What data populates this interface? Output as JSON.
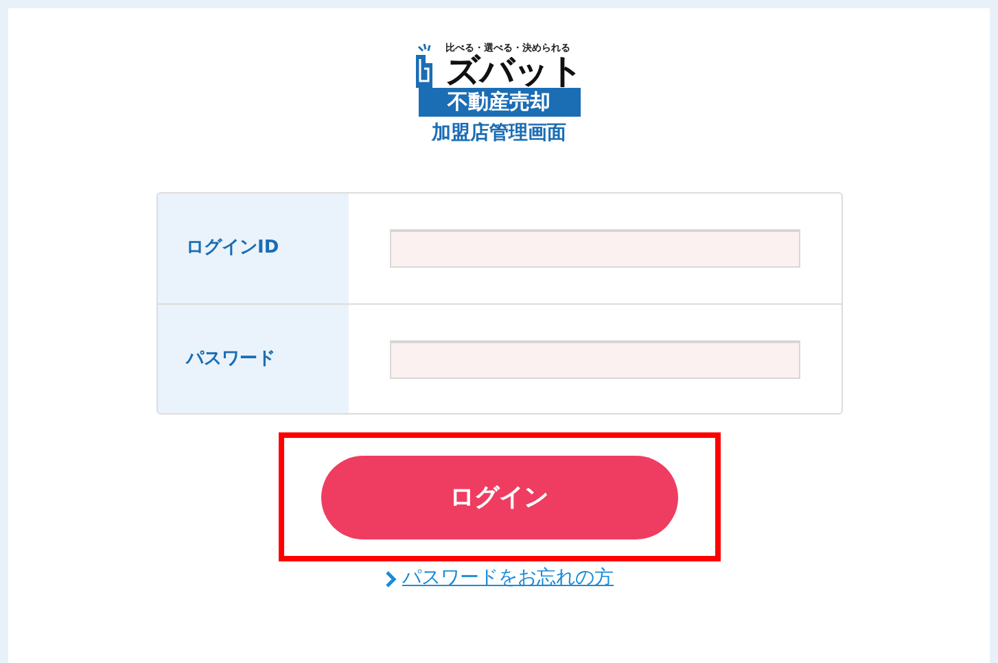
{
  "logo": {
    "tagline": "比べる・選べる・決められる",
    "brand": "ズバット",
    "band": "不動産売却",
    "subtitle": "加盟店管理画面"
  },
  "fields": [
    {
      "label": "ログインID"
    },
    {
      "label": "パスワード"
    }
  ],
  "login_button": {
    "label": "ログイン",
    "highlighted": true
  },
  "forgot_link": {
    "label": "パスワードをお忘れの方"
  }
}
